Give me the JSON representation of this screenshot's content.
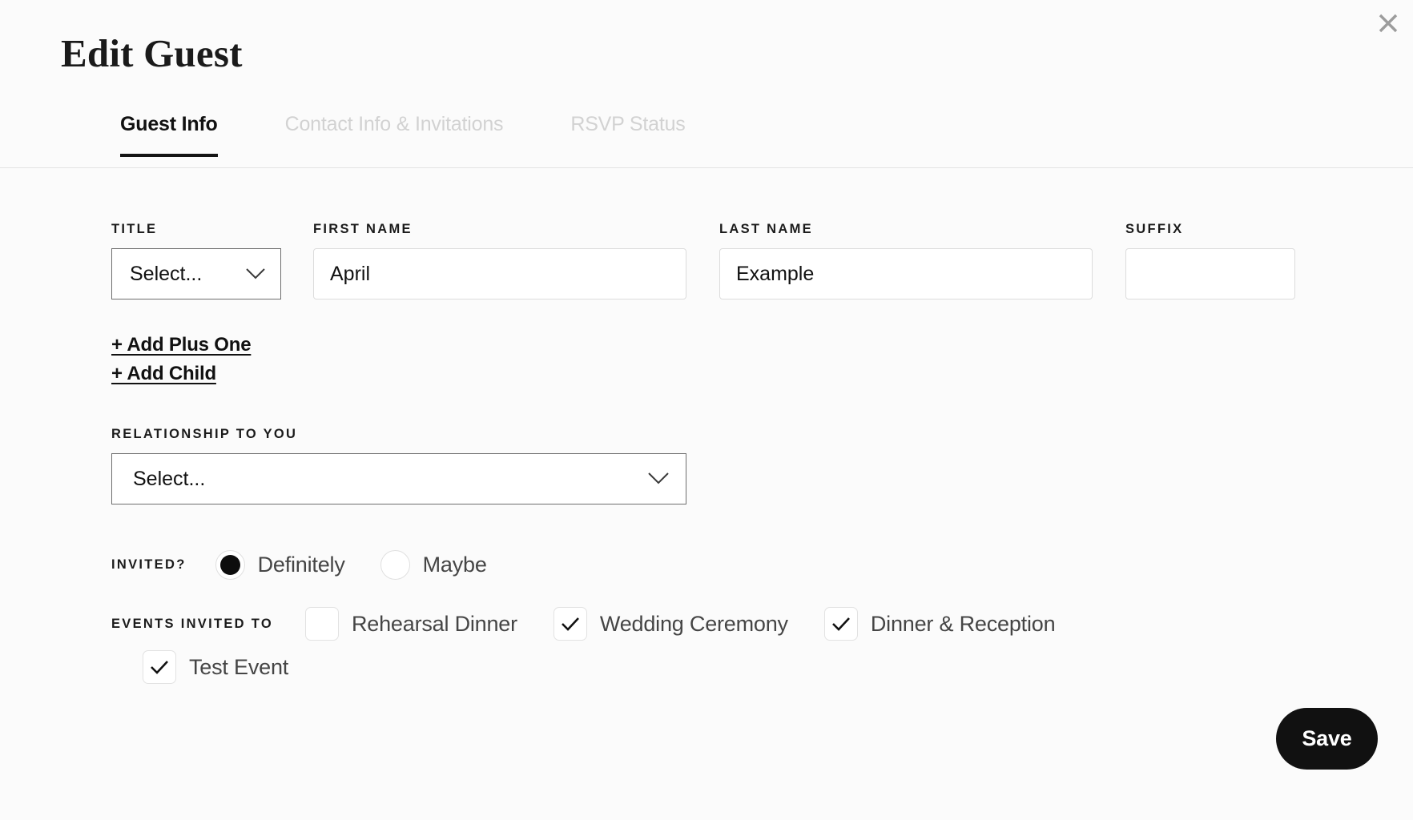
{
  "modal": {
    "title": "Edit Guest",
    "close_icon": "close-icon"
  },
  "tabs": [
    {
      "label": "Guest Info",
      "active": true
    },
    {
      "label": "Contact Info & Invitations",
      "active": false
    },
    {
      "label": "RSVP Status",
      "active": false
    }
  ],
  "form": {
    "title_field": {
      "label": "TITLE",
      "value": "Select...",
      "chevron_icon": "chevron-down-icon"
    },
    "first_name": {
      "label": "FIRST NAME",
      "value": "April",
      "placeholder": ""
    },
    "last_name": {
      "label": "LAST NAME",
      "value": "Example",
      "placeholder": ""
    },
    "suffix": {
      "label": "SUFFIX",
      "value": "",
      "placeholder": ""
    },
    "add_plus_one": "+ Add Plus One",
    "add_child": "+ Add Child",
    "relationship": {
      "label": "RELATIONSHIP TO YOU",
      "value": "Select...",
      "chevron_icon": "chevron-down-icon"
    },
    "invited": {
      "label": "INVITED?",
      "options": [
        {
          "label": "Definitely",
          "checked": true
        },
        {
          "label": "Maybe",
          "checked": false
        }
      ]
    },
    "events": {
      "label": "EVENTS INVITED TO",
      "options": [
        {
          "label": "Rehearsal Dinner",
          "checked": false
        },
        {
          "label": "Wedding Ceremony",
          "checked": true
        },
        {
          "label": "Dinner & Reception",
          "checked": true
        },
        {
          "label": "Test Event",
          "checked": true
        }
      ]
    }
  },
  "footer": {
    "save_label": "Save"
  },
  "colors": {
    "page_background": "#fbfbfb",
    "accent": "#111111",
    "muted_text": "#d2d2d2",
    "border": "#dcdcdc"
  }
}
